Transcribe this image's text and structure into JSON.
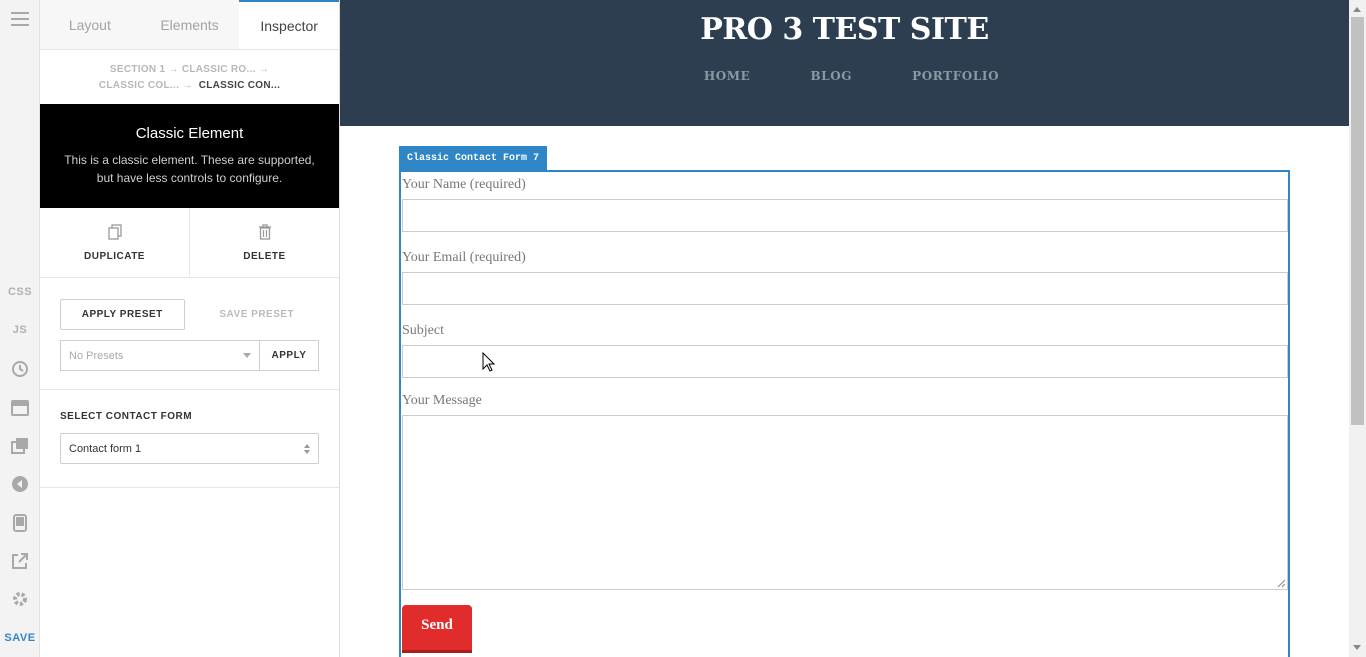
{
  "rail": {
    "css": "CSS",
    "js": "JS",
    "save": "SAVE"
  },
  "panel": {
    "tabs": [
      {
        "label": "Layout"
      },
      {
        "label": "Elements"
      },
      {
        "label": "Inspector"
      }
    ],
    "breadcrumb": {
      "line1": "SECTION 1 → CLASSIC RO...  →",
      "line2a": "CLASSIC COL...  →",
      "line2b": "CLASSIC CON..."
    },
    "element": {
      "title": "Classic Element",
      "description": "This is a classic element. These are supported, but have less controls to configure."
    },
    "actions": {
      "duplicate": "DUPLICATE",
      "delete": "DELETE"
    },
    "presets": {
      "apply_preset": "APPLY PRESET",
      "save_preset": "SAVE PRESET",
      "select_value": "No Presets",
      "apply": "APPLY"
    },
    "contact_form": {
      "label": "SELECT CONTACT FORM",
      "value": "Contact form 1"
    }
  },
  "site": {
    "title": "PRO 3 TEST SITE",
    "nav": [
      "HOME",
      "BLOG",
      "PORTFOLIO"
    ],
    "form_tag": "Classic Contact Form 7",
    "fields": {
      "name": "Your Name (required)",
      "email": "Your Email (required)",
      "subject": "Subject",
      "message": "Your Message"
    },
    "send": "Send"
  },
  "colors": {
    "accent": "#2f86c6",
    "header_bg": "#2c3e50",
    "send_bg": "#e12c2c"
  }
}
